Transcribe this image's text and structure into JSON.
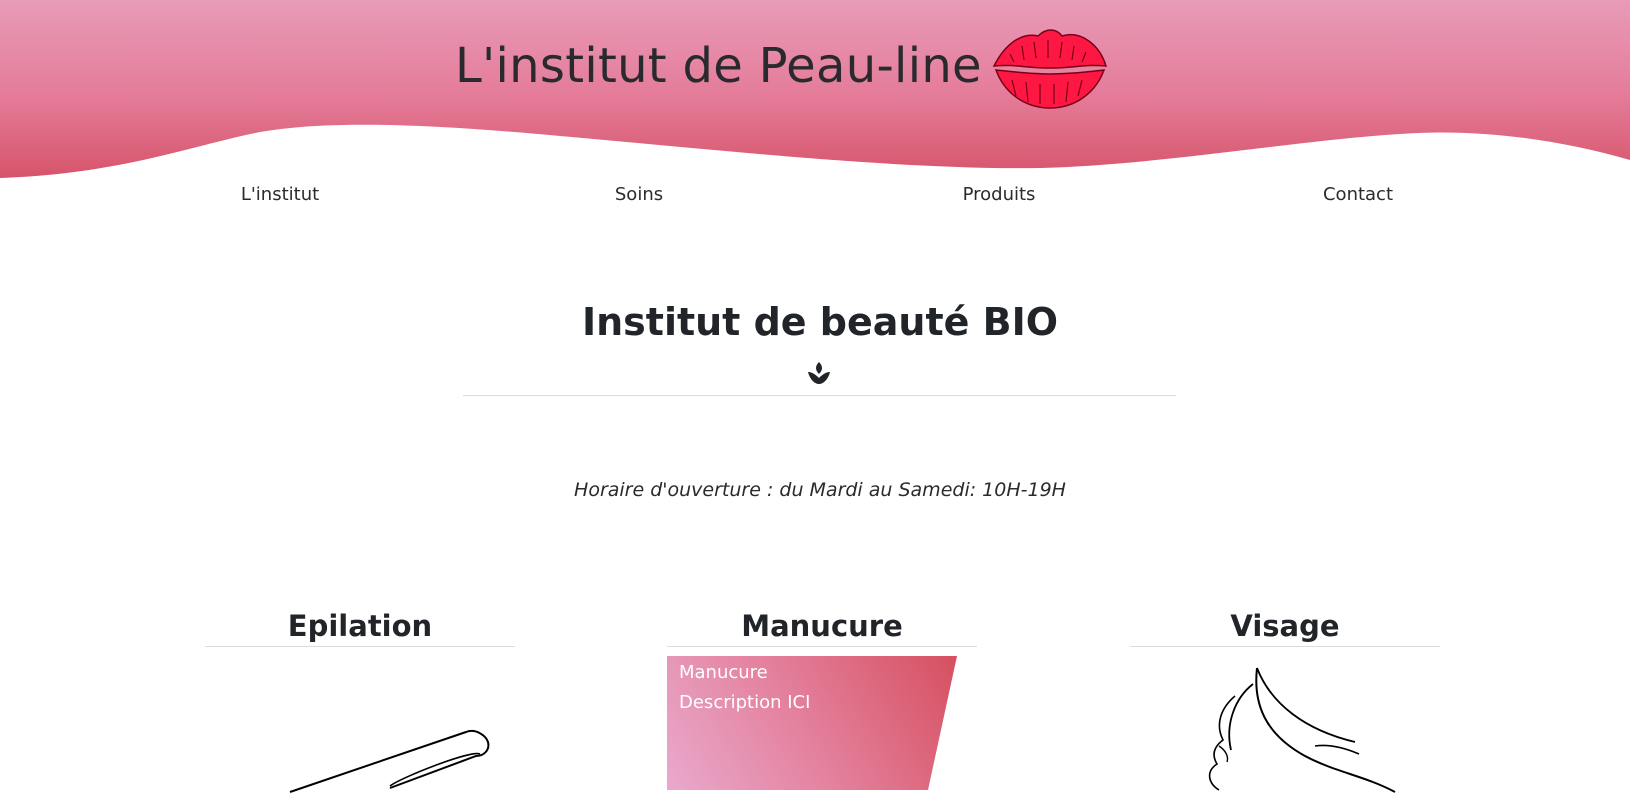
{
  "header": {
    "title": "L'institut de Peau-line",
    "logo_icon": "lips-kiss-icon",
    "colors": {
      "gradient_top": "#e89bb8",
      "gradient_bottom": "#d6546a",
      "lips": "#ff1744"
    }
  },
  "nav": {
    "items": [
      {
        "label": "L'institut"
      },
      {
        "label": "Soins"
      },
      {
        "label": "Produits"
      },
      {
        "label": "Contact"
      }
    ]
  },
  "main": {
    "heading": "Institut de beauté BIO",
    "heading_icon": "lotus-leaf-icon",
    "hours": "Horaire d'ouverture : du Mardi au Samedi: 10H-19H"
  },
  "cards": [
    {
      "title": "Epilation",
      "illustration": "wax-strip-sketch-icon"
    },
    {
      "title": "Manucure",
      "panel_line1": "Manucure",
      "panel_line2": "Description ICI"
    },
    {
      "title": "Visage",
      "illustration": "woman-hair-sketch-icon"
    }
  ]
}
